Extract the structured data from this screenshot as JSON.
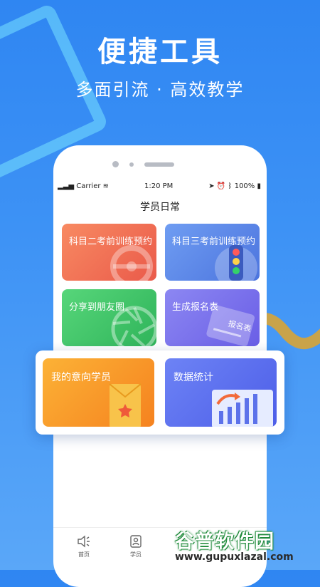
{
  "headline": {
    "title": "便捷工具",
    "subtitle": "多面引流 · 高效教学"
  },
  "status_bar": {
    "carrier": "Carrier",
    "time": "1:20 PM",
    "battery": "100%"
  },
  "page": {
    "title": "学员日常"
  },
  "cards": [
    {
      "label": "科目二考前训练预约",
      "color": "#ee6b51"
    },
    {
      "label": "科目三考前训练预约",
      "color": "#5b86e8"
    },
    {
      "label": "分享到朋友圈",
      "color": "#40c567"
    },
    {
      "label": "生成报名表",
      "color": "#7a72ec"
    }
  ],
  "highlight_cards": [
    {
      "label": "我的意向学员",
      "color": "#f89b2a"
    },
    {
      "label": "数据统计",
      "color": "#5c6ff0"
    }
  ],
  "card_deco": {
    "signup_form_text": "报名表"
  },
  "tabs": [
    {
      "label": "首页",
      "icon": "speaker-icon"
    },
    {
      "label": "学员",
      "icon": "person-card-icon"
    }
  ],
  "watermark": {
    "main": "谷普软件园",
    "url": "www.gupuxlazal.com"
  }
}
